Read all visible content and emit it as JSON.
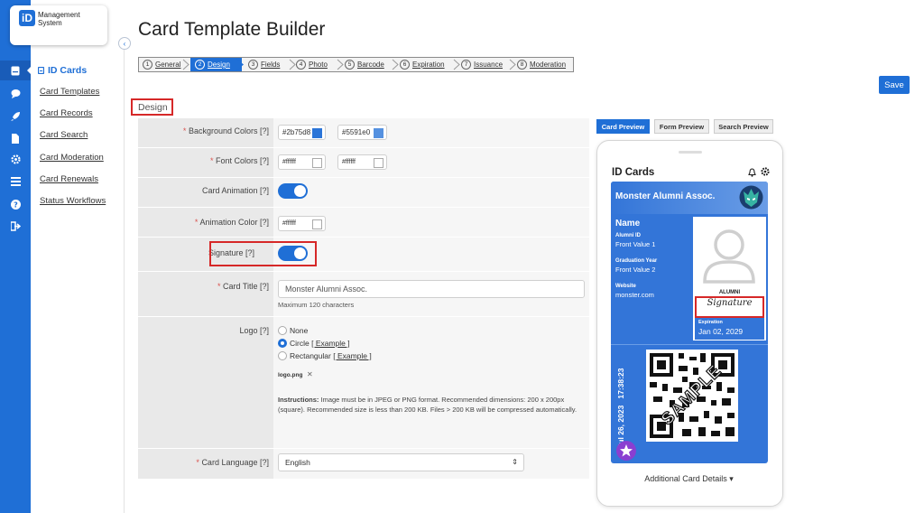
{
  "app": {
    "logo_mark": "iD",
    "logo_text_1": "Management",
    "logo_text_2": "System"
  },
  "subnav": {
    "heading": "ID Cards",
    "items": [
      "Card Templates",
      "Card Records",
      "Card Search",
      "Card Moderation",
      "Card Renewals",
      "Status Workflows"
    ]
  },
  "page": {
    "title": "Card Template Builder",
    "save_label": "Save",
    "section_label": "Design"
  },
  "steps": [
    {
      "num": "1",
      "label": "General"
    },
    {
      "num": "2",
      "label": "Design"
    },
    {
      "num": "3",
      "label": "Fields"
    },
    {
      "num": "4",
      "label": "Photo"
    },
    {
      "num": "5",
      "label": "Barcode"
    },
    {
      "num": "6",
      "label": "Expiration"
    },
    {
      "num": "7",
      "label": "Issuance"
    },
    {
      "num": "8",
      "label": "Moderation"
    }
  ],
  "form": {
    "required_mark": "*",
    "bg_colors_label": "Background Colors [?]",
    "bg_color_1": "#2b75d8",
    "bg_color_2": "#5591e0",
    "font_colors_label": "Font Colors [?]",
    "font_color_1": "#ffffff",
    "font_color_2": "#ffffff",
    "card_animation_label": "Card Animation [?]",
    "animation_color_label": "Animation Color [?]",
    "animation_color": "#ffffff",
    "signature_label": "Signature [?]",
    "card_title_label": "Card Title [?]",
    "card_title_value": "Monster Alumni Assoc.",
    "card_title_hint": "Maximum 120 characters",
    "logo_label": "Logo [?]",
    "logo_opt_none": "None",
    "logo_opt_circle": "Circle",
    "logo_opt_rect": "Rectangular",
    "example_link": "[ Example ]",
    "logo_file": "logo.png",
    "remove_glyph": "✕",
    "instructions_bold": "Instructions:",
    "instructions_text": " Image must be in JPEG or PNG format. Recommended dimensions: 200 x 200px (square). Recommended size is less than 200 KB. Files > 200 KB will be compressed automatically.",
    "card_language_label": "Card Language [?]",
    "card_language_value": "English",
    "select_arrows": "⇕"
  },
  "preview": {
    "tabs": [
      "Card Preview",
      "Form Preview",
      "Search Preview"
    ],
    "app_title": "ID Cards",
    "card_title": "Monster Alumni Assoc.",
    "name": "Name",
    "f1_label": "Alumni ID",
    "f1_value": "Front Value 1",
    "f2_label": "Graduation Year",
    "f2_value": "Front Value 2",
    "f3_label": "Website",
    "f3_value": "monster.com",
    "badge": "ALUMNI",
    "signature": "Signature",
    "exp_label": "Expiration",
    "exp_value": "Jan 02, 2029",
    "date_vertical": "Jul 26, 2023   17:38:23",
    "sample": "SAMPLE",
    "more": "Additional Card Details ▾"
  },
  "colors": {
    "brand": "#1f6fd6",
    "card": "#3375d8",
    "highlight": "#d62828"
  }
}
